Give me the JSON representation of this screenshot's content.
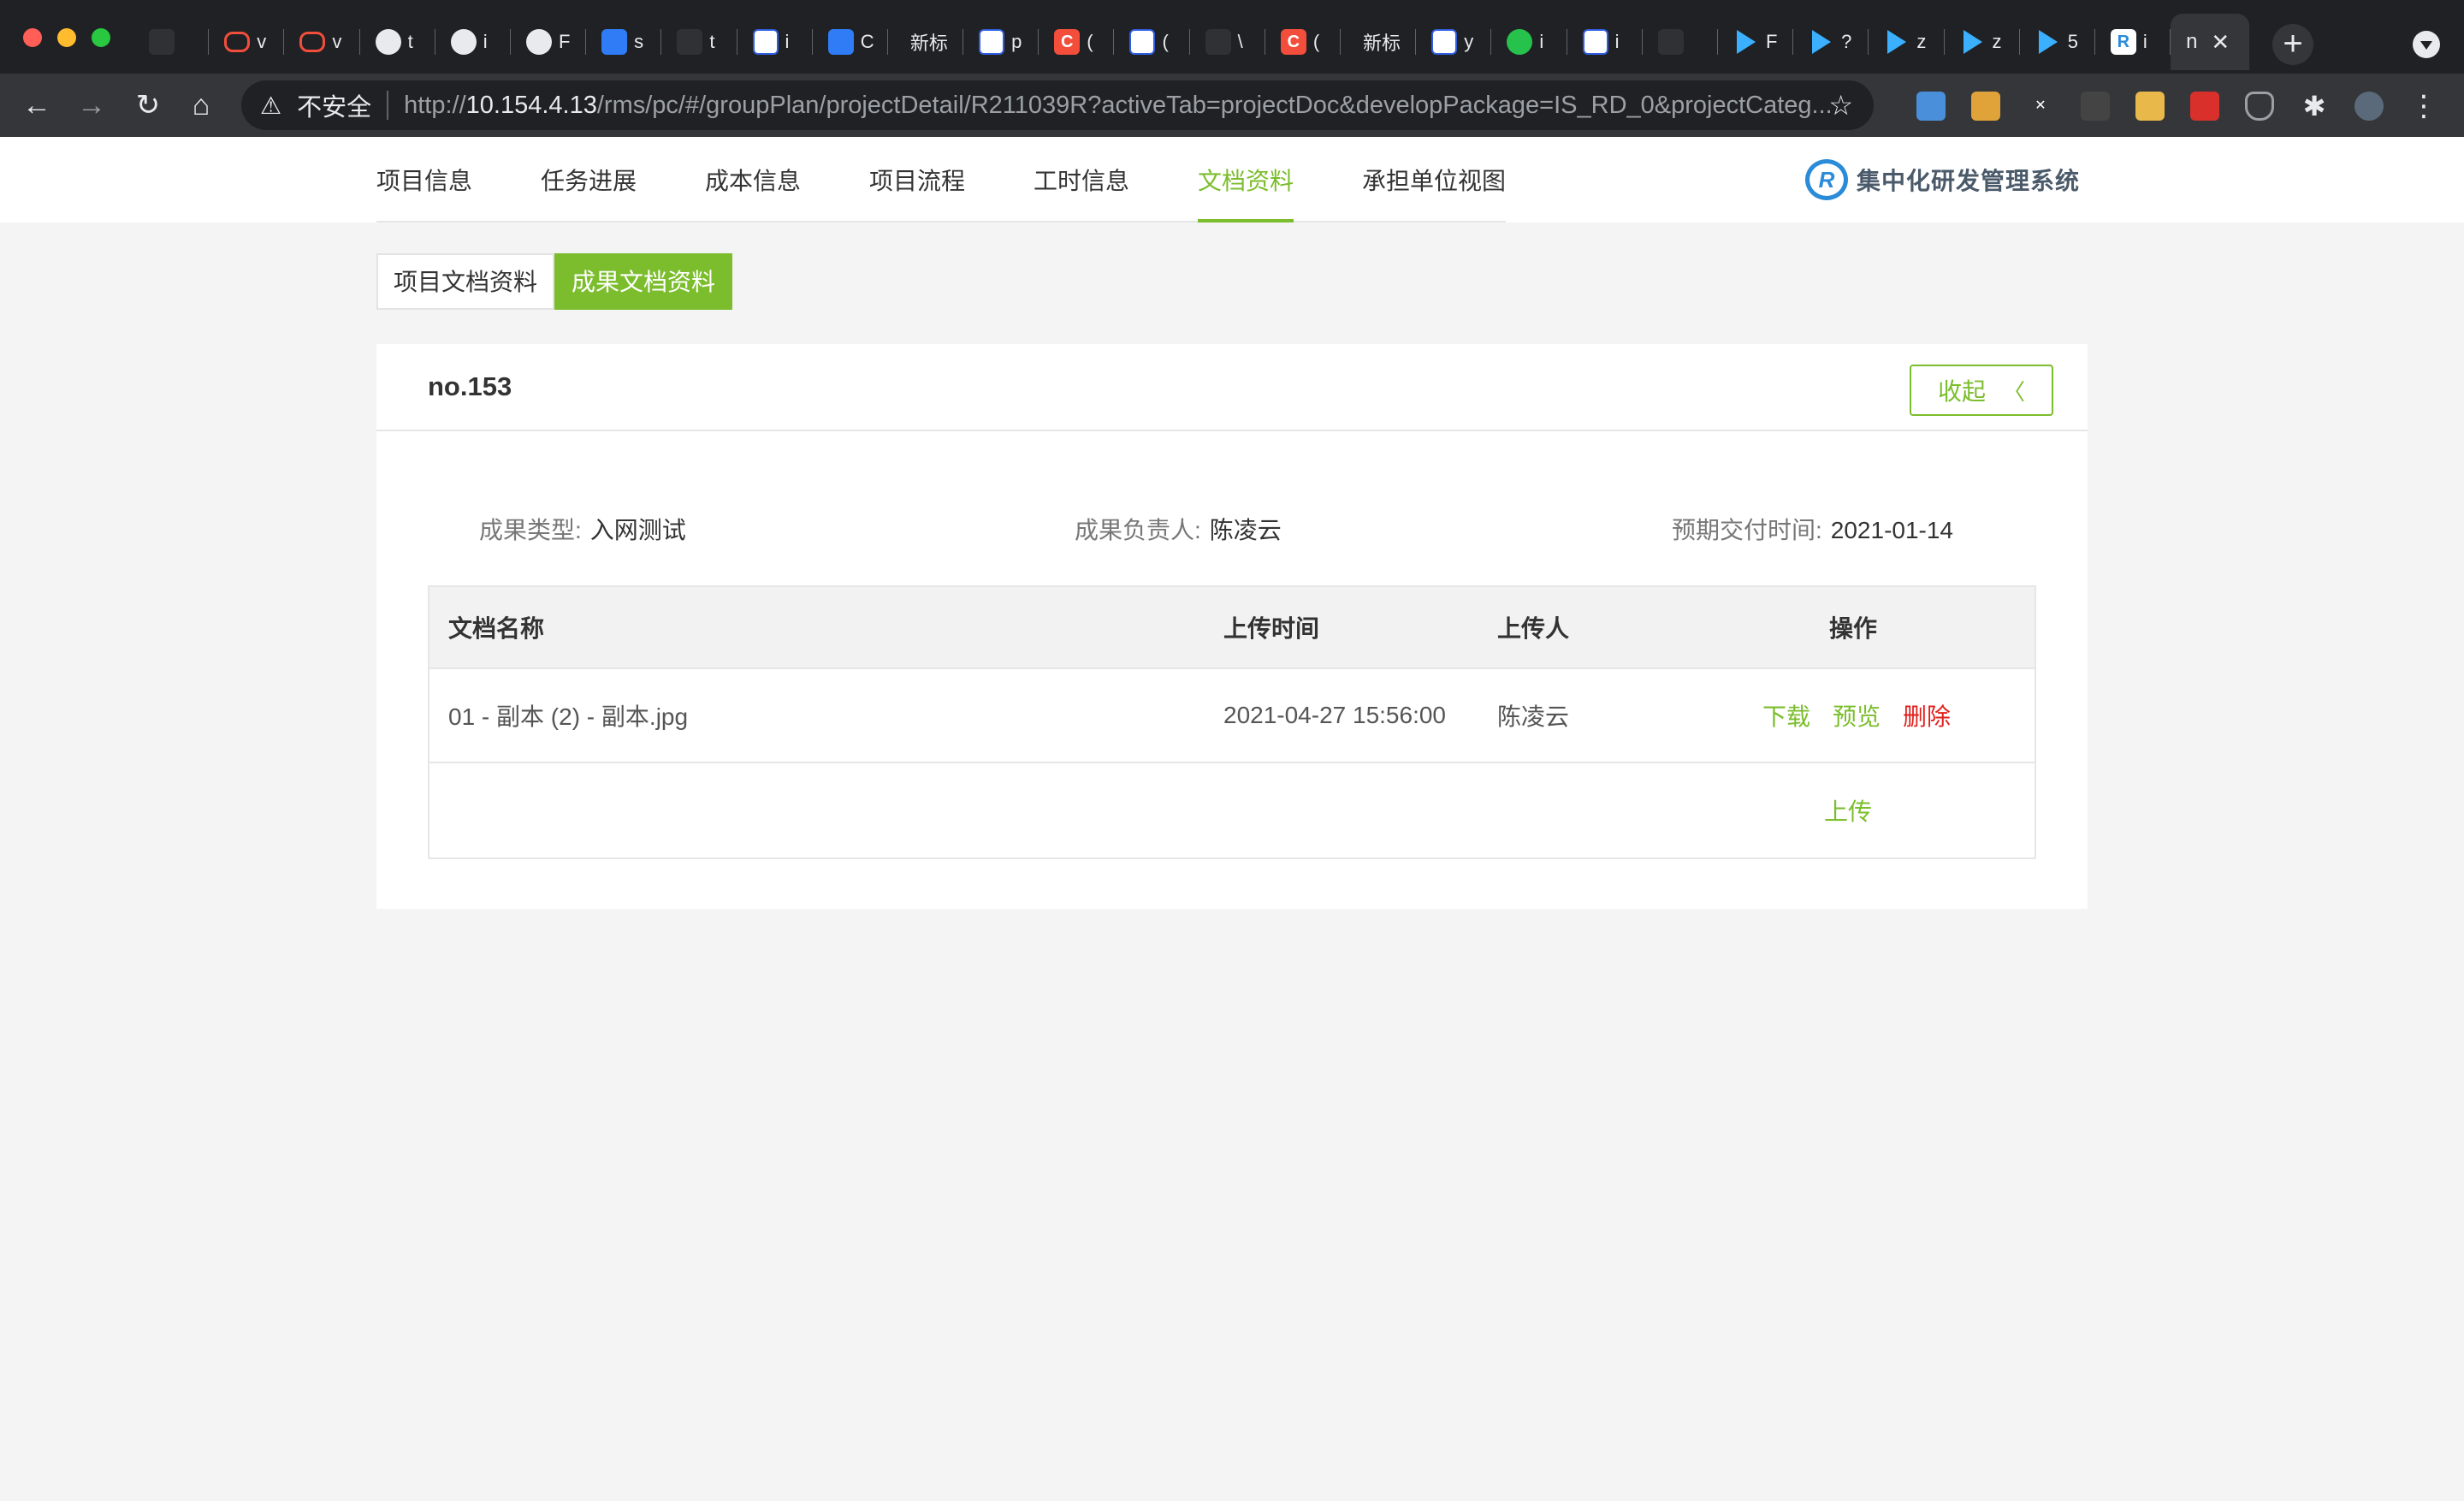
{
  "browser": {
    "tabs": [
      {
        "icon": "blank-icon",
        "kind": "none",
        "title": ""
      },
      {
        "icon": "robot-icon",
        "kind": "red-o",
        "title": "v"
      },
      {
        "icon": "robot-icon",
        "kind": "red-o",
        "title": "v"
      },
      {
        "icon": "globe-icon",
        "kind": "globe",
        "title": "t"
      },
      {
        "icon": "globe-icon",
        "kind": "globe",
        "title": "i"
      },
      {
        "icon": "globe-icon",
        "kind": "globe",
        "title": "F"
      },
      {
        "icon": "cube-icon",
        "kind": "blue",
        "title": "s"
      },
      {
        "icon": "bird-icon",
        "kind": "none",
        "title": "t"
      },
      {
        "icon": "baidu-icon",
        "kind": "baidu",
        "title": "i"
      },
      {
        "icon": "translate-icon",
        "kind": "blue",
        "title": "C"
      },
      {
        "icon": "",
        "kind": "text",
        "title": "新标"
      },
      {
        "icon": "baidu-icon",
        "kind": "baidu",
        "title": "p"
      },
      {
        "icon": "csdn-icon",
        "kind": "red",
        "title": "("
      },
      {
        "icon": "baidu-icon",
        "kind": "baidu",
        "title": "("
      },
      {
        "icon": "github-icon",
        "kind": "none",
        "title": "\\"
      },
      {
        "icon": "csdn-icon",
        "kind": "red",
        "title": "("
      },
      {
        "icon": "",
        "kind": "text",
        "title": "新标"
      },
      {
        "icon": "baidu-icon",
        "kind": "baidu",
        "title": "y"
      },
      {
        "icon": "wechat-icon",
        "kind": "green",
        "title": "i"
      },
      {
        "icon": "baidu-icon",
        "kind": "baidu",
        "title": "i"
      },
      {
        "icon": "eye-icon",
        "kind": "none",
        "title": ""
      },
      {
        "icon": "play-icon",
        "kind": "play",
        "title": "F"
      },
      {
        "icon": "play-icon",
        "kind": "play",
        "title": "?"
      },
      {
        "icon": "play-icon",
        "kind": "play",
        "title": "z"
      },
      {
        "icon": "play-icon",
        "kind": "play",
        "title": "z"
      },
      {
        "icon": "play-icon",
        "kind": "play",
        "title": "5"
      },
      {
        "icon": "rp-logo-icon",
        "kind": "rp",
        "title": "i"
      }
    ],
    "active_tab_title": "n",
    "insecure_label": "不安全",
    "url_scheme": "http://",
    "url_host": "10.154.4.13",
    "url_rest": "/rms/pc/#/groupPlan/projectDetail/R211039R?activeTab=projectDoc&developPackage=IS_RD_0&projectCateg..."
  },
  "app": {
    "brand_name": "集中化研发管理系统",
    "nav": [
      {
        "label": "项目信息",
        "active": false
      },
      {
        "label": "任务进展",
        "active": false
      },
      {
        "label": "成本信息",
        "active": false
      },
      {
        "label": "项目流程",
        "active": false
      },
      {
        "label": "工时信息",
        "active": false
      },
      {
        "label": "文档资料",
        "active": true
      },
      {
        "label": "承担单位视图",
        "active": false
      }
    ],
    "subtabs": [
      {
        "label": "项目文档资料",
        "active": false
      },
      {
        "label": "成果文档资料",
        "active": true
      }
    ],
    "card": {
      "title": "no.153",
      "collapse_label": "收起",
      "meta": {
        "type_label": "成果类型:",
        "type_value": "入网测试",
        "owner_label": "成果负责人:",
        "owner_value": "陈凌云",
        "due_label": "预期交付时间:",
        "due_value": "2021-01-14"
      },
      "table": {
        "headers": [
          "文档名称",
          "上传时间",
          "上传人",
          "操作"
        ],
        "rows": [
          {
            "name": "01 - 副本 (2) - 副本.jpg",
            "time": "2021-04-27 15:56:00",
            "uploader": "陈凌云",
            "actions": [
              "下载",
              "预览",
              "删除"
            ]
          }
        ],
        "upload_label": "上传"
      }
    }
  },
  "colors": {
    "accent": "#7bbd2c",
    "danger": "#e0201c",
    "chrome_dark": "#202124"
  }
}
